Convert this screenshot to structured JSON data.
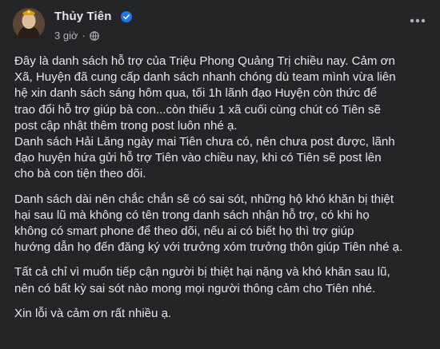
{
  "post": {
    "author": "Thủy Tiên",
    "time": "3 giờ",
    "separator": "·",
    "verified_icon": "verified-badge-icon",
    "audience_icon": "globe-icon",
    "more_icon": "more-options-icon",
    "accent_color": "#1877f2",
    "lines": [
      "Đây là danh sách hỗ trợ của Triệu Phong Quảng Trị chiều nay. Cảm ơn",
      "Xã, Huyện đã cung cấp danh sách nhanh chóng dù team mình vừa liên",
      "hệ xin danh sách sáng hôm qua, tối 1h lãnh đạo Huyện còn thức để",
      "trao đổi hỗ trợ giúp bà con...còn thiếu 1 xã cuối cùng chút có Tiên sẽ",
      "post cập nhật thêm trong post luôn nhé ạ.",
      "Danh sách Hải Lăng ngày mai Tiên chưa có, nên chưa post được, lãnh",
      "đạo huyện hứa gửi hỗ trợ Tiên vào chiều nay, khi có Tiên sẽ post lên",
      "cho bà con tiện theo dõi.",
      "Danh sách dài nên chắc chắn sẽ có sai sót, những hộ khó khăn bị thiệt",
      "hại sau lũ mà không có tên trong danh sách nhận hỗ trợ, có khi họ",
      "không có smart phone để theo dõi, nếu ai có biết họ thì trợ giúp",
      "hướng dẫn họ đến đăng ký với trưởng xóm trưởng thôn giúp Tiên nhé ạ.",
      "Tất cả chỉ vì muốn tiếp cận người bị thiệt hại nặng và khó khăn sau lũ,",
      "nên có bất kỳ sai sót nào mong mọi người thông cảm cho Tiên nhé.",
      "Xin lỗi và cảm ơn rất nhiều ạ."
    ]
  }
}
